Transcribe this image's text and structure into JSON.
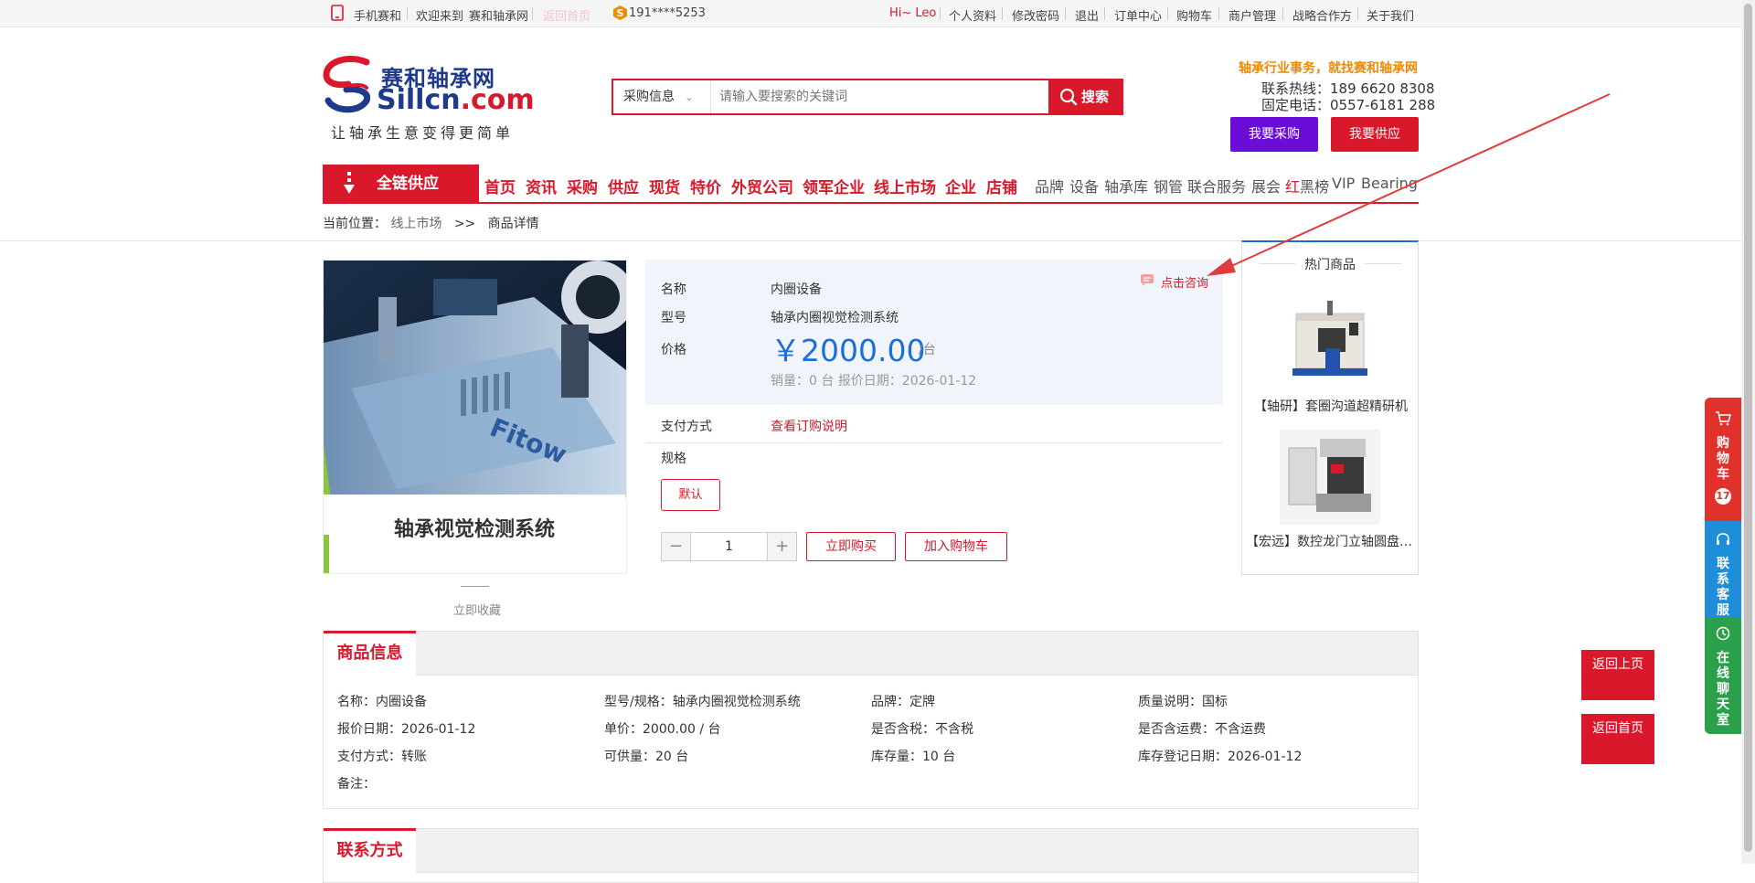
{
  "topbar": {
    "mobile": "手机赛和",
    "welcome": "欢迎来到",
    "site": "赛和轴承网",
    "faded": "返回首页",
    "phone": "191****5253",
    "hi": "Hi~ Leo",
    "links": [
      "个人资料",
      "修改密码",
      "退出",
      "订单中心",
      "购物车",
      "商户管理",
      "战略合作方",
      "关于我们"
    ]
  },
  "header": {
    "logo_cn": "赛和轴承网",
    "logo_en_a": "Sillcn",
    "logo_en_b": ".com",
    "slogan": "让轴承生意变得更简单",
    "search_category": "采购信息",
    "search_placeholder": "请输入要搜索的关键词",
    "search_button": "搜索",
    "tagline": "轴承行业事务，就找赛和轴承网",
    "hotline": "联系热线：189 6620 8308",
    "fixed_phone": "固定电话：0557-6181 288",
    "buy_button": "我要采购",
    "supply_button": "我要供应"
  },
  "nav": {
    "all": "全链供应",
    "main": [
      "首页",
      "资讯",
      "采购",
      "供应",
      "现货",
      "特价",
      "外贸公司",
      "领军企业",
      "线上市场",
      "企业",
      "店铺"
    ],
    "sub": [
      "品牌",
      "设备",
      "轴承库",
      "钢管",
      "联合服务",
      "展会"
    ],
    "rank_a": "红",
    "rank_b": "黑榜",
    "vip": "VIP",
    "bearing": "Bearing"
  },
  "breadcrumb": {
    "label": "当前位置：",
    "market": "线上市场",
    "sep": ">>",
    "current": "商品详情"
  },
  "product": {
    "image_caption": "轴承视觉检测系统",
    "favorite": "立即收藏",
    "name_label": "名称",
    "name": "内圈设备",
    "model_label": "型号",
    "model": "轴承内圈视觉检测系统",
    "price_label": "价格",
    "price": "￥2000.00",
    "unit": "/台",
    "meta": "销量：0 台   报价日期：2026-01-12",
    "consult": "点击咨询",
    "pay_label": "支付方式",
    "pay_link": "查看订购说明",
    "spec_label": "规格",
    "spec_option": "默认",
    "qty": "1",
    "minus": "−",
    "plus": "+",
    "buy_now": "立即购买",
    "add_cart": "加入购物车"
  },
  "hot": {
    "title": "热门商品",
    "items": [
      "【轴研】套圈沟道超精研机",
      "【宏远】数控龙门立轴圆盘平面磨床"
    ]
  },
  "info": {
    "tab": "商品信息",
    "rows": [
      [
        "名称：",
        "内圈设备",
        "型号/规格：",
        "轴承内圈视觉检测系统",
        "品牌：",
        "定牌",
        "质量说明：",
        "国标"
      ],
      [
        "报价日期：",
        "2026-01-12",
        "单价：",
        "2000.00 / 台",
        "是否含税：",
        "不含税",
        "是否含运费：",
        "不含运费"
      ],
      [
        "支付方式：",
        "转账",
        "可供量：",
        "20 台",
        "库存量：",
        "10 台",
        "库存登记日期：",
        "2026-01-12"
      ]
    ],
    "remark": "备注："
  },
  "contact": {
    "tab": "联系方式"
  },
  "side": {
    "cart": "购物车",
    "cart_count": "17",
    "service": "联系客服",
    "chat": "在线聊天室",
    "back_top": "返回上页",
    "back_home": "返回首页"
  },
  "colors": {
    "brand_red": "#d9182b",
    "price_blue": "#1a6fd8",
    "purple": "#6a0dd8",
    "tag_orange": "#f08a00"
  }
}
